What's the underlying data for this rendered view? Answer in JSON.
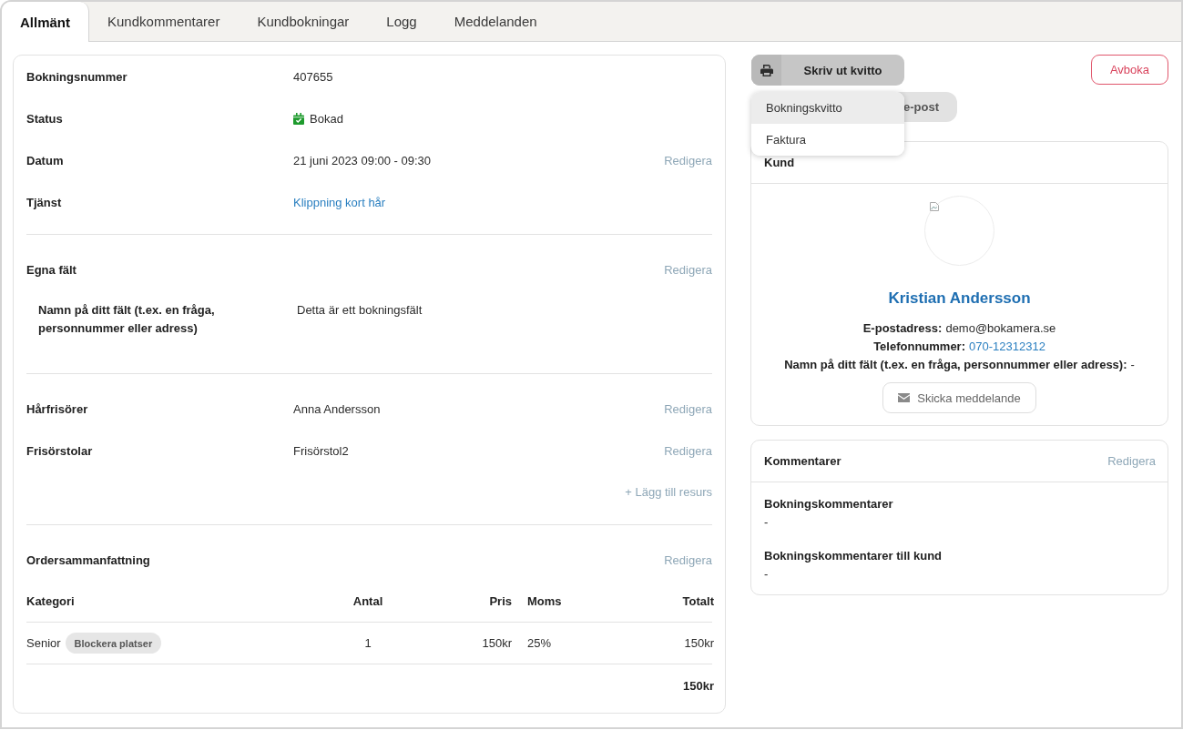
{
  "tabs": [
    {
      "label": "Allmänt",
      "selected": true
    },
    {
      "label": "Kundkommentarer",
      "selected": false
    },
    {
      "label": "Kundbokningar",
      "selected": false
    },
    {
      "label": "Logg",
      "selected": false
    },
    {
      "label": "Meddelanden",
      "selected": false
    }
  ],
  "booking": {
    "rows": [
      {
        "label": "Bokningsnummer",
        "value": "407655",
        "kind": "text"
      },
      {
        "label": "Status",
        "value": "Bokad",
        "kind": "status"
      },
      {
        "label": "Datum",
        "value": "21 juni 2023 09:00 - 09:30",
        "kind": "text",
        "action": "Redigera"
      },
      {
        "label": "Tjänst",
        "value": "Klippning kort hår",
        "kind": "link"
      }
    ]
  },
  "custom_fields": {
    "title": "Egna fält",
    "action": "Redigera",
    "fields": [
      {
        "label": "Namn på ditt fält (t.ex. en fråga, personnummer eller adress)",
        "value": "Detta är ett bokningsfält"
      }
    ]
  },
  "resources": {
    "rows": [
      {
        "label": "Hårfrisörer",
        "value": "Anna Andersson",
        "action": "Redigera"
      },
      {
        "label": "Frisörstolar",
        "value": "Frisörstol2",
        "action": "Redigera"
      }
    ],
    "add_link": "+ Lägg till resurs"
  },
  "order_summary": {
    "title": "Ordersammanfattning",
    "action": "Redigera",
    "columns": [
      "Kategori",
      "Antal",
      "Pris",
      "Moms",
      "Totalt"
    ],
    "rows": [
      {
        "category": "Senior",
        "badge": "Blockera platser",
        "quantity": "1",
        "price": "150kr",
        "vat": "25%",
        "total": "150kr"
      }
    ],
    "grand_total": "150kr"
  },
  "actions": {
    "print_button": "Skriv ut kvitto",
    "cancel_button": "Avboka",
    "email_button": "e-post"
  },
  "print_menu": [
    {
      "label": "Bokningskvitto",
      "selected": true
    },
    {
      "label": "Faktura",
      "selected": false
    }
  ],
  "customer": {
    "title": "Kund",
    "name": "Kristian Andersson",
    "fields": [
      {
        "label": "E-postadress:",
        "value": "demo@bokamera.se",
        "kind": "text"
      },
      {
        "label": "Telefonnummer:",
        "value": "070-12312312",
        "kind": "link"
      },
      {
        "label": "Namn på ditt fält (t.ex. en fråga, personnummer eller adress):",
        "value": "-",
        "kind": "text"
      }
    ],
    "message_button": "Skicka meddelande"
  },
  "comments": {
    "title": "Kommentarer",
    "action": "Redigera",
    "items": [
      {
        "label": "Bokningskommentarer",
        "value": "-"
      },
      {
        "label": "Bokningskommentarer till kund",
        "value": "-"
      }
    ]
  }
}
